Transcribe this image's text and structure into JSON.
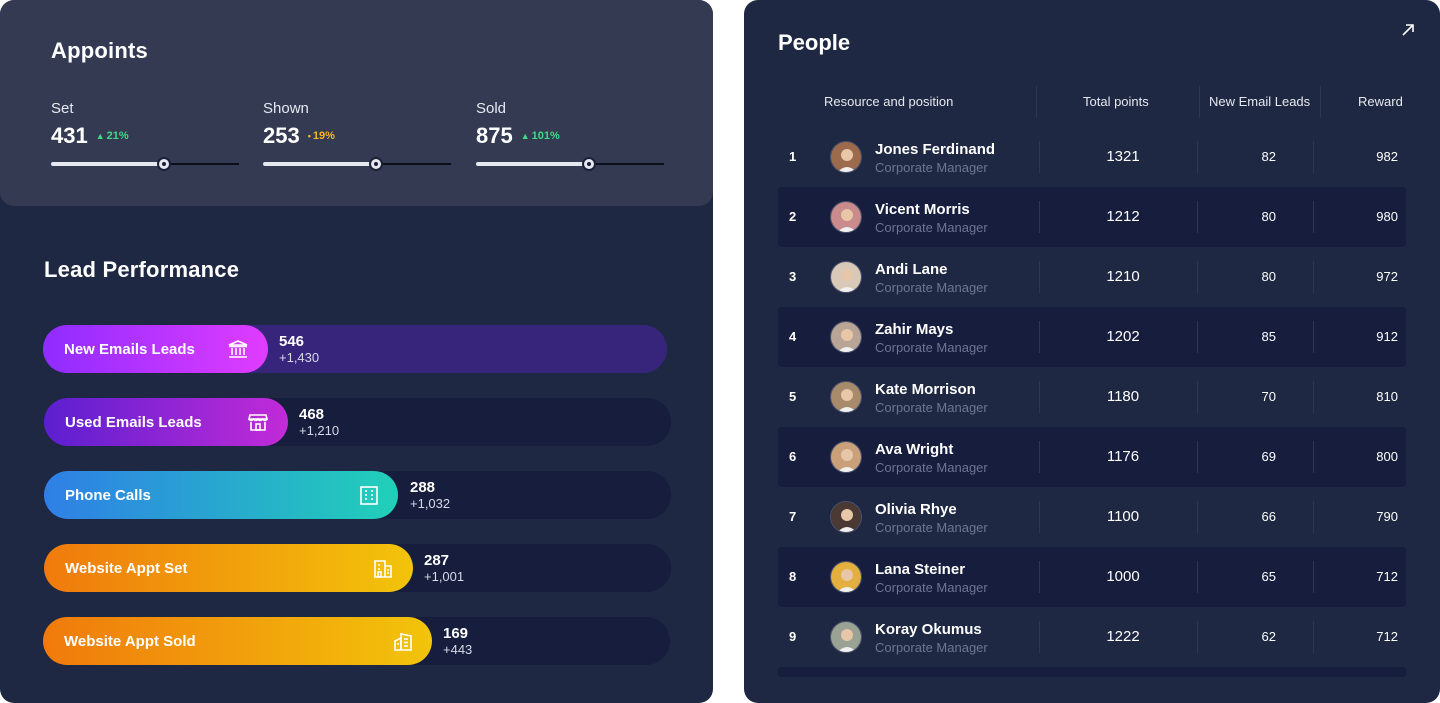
{
  "appoints": {
    "title": "Appoints",
    "stats": [
      {
        "label": "Set",
        "value": "431",
        "change": "21%",
        "trend": "up",
        "progress": 0.6
      },
      {
        "label": "Shown",
        "value": "253",
        "change": "19%",
        "trend": "neutral",
        "progress": 0.6
      },
      {
        "label": "Sold",
        "value": "875",
        "change": "101%",
        "trend": "up",
        "progress": 0.6
      }
    ]
  },
  "lead_performance": {
    "title": "Lead Performance",
    "items": [
      {
        "label": "New Emails Leads",
        "value": "546",
        "delta": "+1,430",
        "icon": "bank-icon",
        "colors": [
          "#8f2cff",
          "#e03cff"
        ]
      },
      {
        "label": "Used Emails Leads",
        "value": "468",
        "delta": "+1,210",
        "icon": "storefront-icon",
        "colors": [
          "#5b1fcf",
          "#c22bd8"
        ]
      },
      {
        "label": "Phone Calls",
        "value": "288",
        "delta": "+1,032",
        "icon": "office-building-icon",
        "colors": [
          "#2f7fe6",
          "#21d0b8"
        ]
      },
      {
        "label": "Website Appt Set",
        "value": "287",
        "delta": "+1,001",
        "icon": "city-building-icon",
        "colors": [
          "#f07a0c",
          "#f2c40b"
        ]
      },
      {
        "label": "Website Appt Sold",
        "value": "169",
        "delta": "+443",
        "icon": "buildings-icon",
        "colors": [
          "#f07a0c",
          "#f2c40b"
        ]
      }
    ]
  },
  "people": {
    "title": "People",
    "columns": [
      "Resource and position",
      "Total points",
      "New Email Leads",
      "Reward"
    ],
    "rows": [
      {
        "rank": "1",
        "name": "Jones Ferdinand",
        "position": "Corporate Manager",
        "points": "1321",
        "leads": "82",
        "reward": "982",
        "avatar_color": "#9c6b4e"
      },
      {
        "rank": "2",
        "name": "Vicent Morris",
        "position": "Corporate Manager",
        "points": "1212",
        "leads": "80",
        "reward": "980",
        "avatar_color": "#c98b8b"
      },
      {
        "rank": "3",
        "name": "Andi Lane",
        "position": "Corporate Manager",
        "points": "1210",
        "leads": "80",
        "reward": "972",
        "avatar_color": "#d9c9b8"
      },
      {
        "rank": "4",
        "name": "Zahir Mays",
        "position": "Corporate Manager",
        "points": "1202",
        "leads": "85",
        "reward": "912",
        "avatar_color": "#b8a595"
      },
      {
        "rank": "5",
        "name": "Kate Morrison",
        "position": "Corporate Manager",
        "points": "1180",
        "leads": "70",
        "reward": "810",
        "avatar_color": "#a88b6a"
      },
      {
        "rank": "6",
        "name": "Ava Wright",
        "position": "Corporate Manager",
        "points": "1176",
        "leads": "69",
        "reward": "800",
        "avatar_color": "#c9a07a"
      },
      {
        "rank": "7",
        "name": "Olivia Rhye",
        "position": "Corporate Manager",
        "points": "1100",
        "leads": "66",
        "reward": "790",
        "avatar_color": "#4a3a33"
      },
      {
        "rank": "8",
        "name": "Lana Steiner",
        "position": "Corporate Manager",
        "points": "1000",
        "leads": "65",
        "reward": "712",
        "avatar_color": "#e3b040"
      },
      {
        "rank": "9",
        "name": "Koray Okumus",
        "position": "Corporate Manager",
        "points": "1222",
        "leads": "62",
        "reward": "712",
        "avatar_color": "#9aa294"
      }
    ]
  }
}
